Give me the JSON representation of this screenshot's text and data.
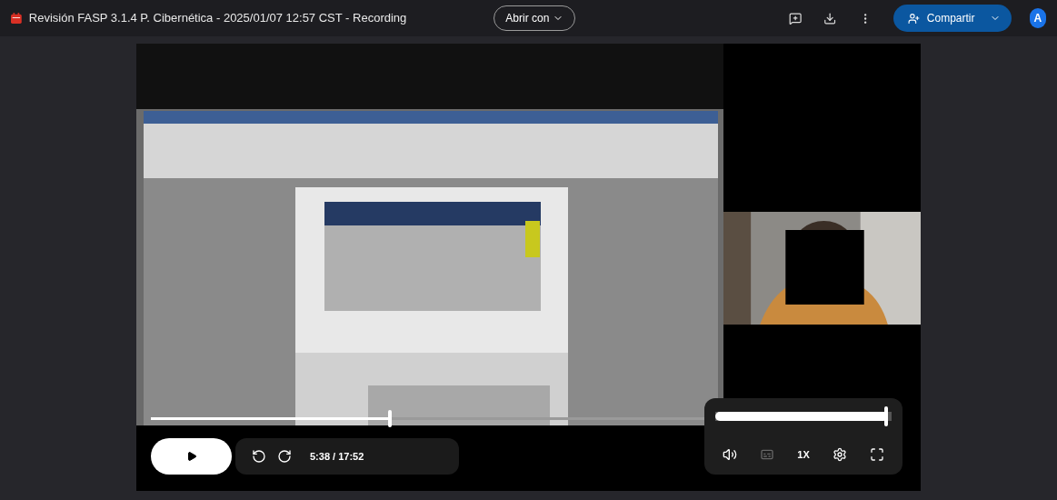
{
  "title": "Revisión FASP 3.1.4 P. Cibernética - 2025/01/07 12:57 CST - Recording",
  "open_with": {
    "label": "Abrir con"
  },
  "share": {
    "label": "Compartir"
  },
  "avatar": "A",
  "player": {
    "playing": false,
    "progress": {
      "level": 0.43
    },
    "volume": {
      "level": 0.98
    },
    "time_current": "5:38",
    "time_total": "/ 17:52",
    "speed": "1X",
    "captions": {
      "disabled": true
    }
  }
}
